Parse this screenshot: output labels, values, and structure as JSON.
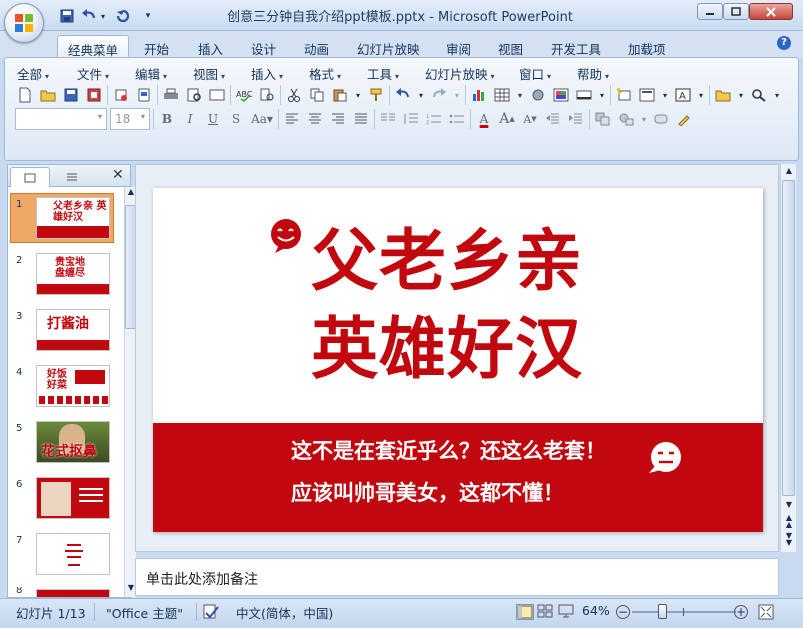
{
  "window": {
    "title": "创意三分钟自我介绍ppt模板.pptx - Microsoft PowerPoint",
    "controls": [
      "minimize",
      "maximize",
      "close"
    ]
  },
  "quick_access": [
    "save-icon",
    "undo-icon",
    "redo-icon",
    "customize-icon"
  ],
  "ribbon_tabs": [
    {
      "label": "经典菜单",
      "active": true
    },
    {
      "label": "开始"
    },
    {
      "label": "插入"
    },
    {
      "label": "设计"
    },
    {
      "label": "动画"
    },
    {
      "label": "幻灯片放映"
    },
    {
      "label": "审阅"
    },
    {
      "label": "视图"
    },
    {
      "label": "开发工具"
    },
    {
      "label": "加载项"
    }
  ],
  "classic_menu": [
    "全部",
    "文件",
    "编辑",
    "视图",
    "插入",
    "格式",
    "工具",
    "幻灯片放映",
    "窗口",
    "帮助"
  ],
  "format_bar": {
    "font_name": "",
    "font_size": "18"
  },
  "slide_thumbnails": [
    {
      "number": "1",
      "title": "父老乡亲 英雄好汉",
      "selected": true
    },
    {
      "number": "2",
      "title": "贵宝地 盘缠尽"
    },
    {
      "number": "3",
      "title": "打酱油"
    },
    {
      "number": "4",
      "title": "好饭 好菜"
    },
    {
      "number": "5",
      "title": "花式抠鼻"
    },
    {
      "number": "6",
      "title": ""
    },
    {
      "number": "7",
      "title": ""
    },
    {
      "number": "8",
      "title": ""
    }
  ],
  "slide": {
    "title_line1": "父老乡亲",
    "title_line2": "英雄好汉",
    "band_line1": "这不是在套近乎么？还这么老套！",
    "band_line2": "应该叫帅哥美女，这都不懂！",
    "accent_red": "#c0080e"
  },
  "notes": {
    "placeholder": "单击此处添加备注"
  },
  "status": {
    "slide_counter": "幻灯片 1/13",
    "theme": "\"Office 主题\"",
    "language": "中文(简体，中国)",
    "zoom": "64%"
  }
}
